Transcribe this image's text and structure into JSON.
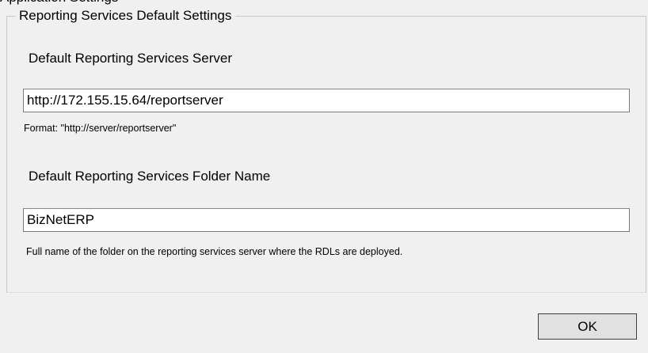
{
  "window": {
    "clipped_title": "Application Settings"
  },
  "group": {
    "title": "Reporting Services Default Settings"
  },
  "server": {
    "label": "Default Reporting Services Server",
    "value": "http://172.155.15.64/reportserver",
    "hint": "Format: \"http://server/reportserver\""
  },
  "folder": {
    "label": "Default Reporting Services Folder Name",
    "value": "BizNetERP",
    "hint": "Full name of the folder on the reporting services server where the RDLs are deployed."
  },
  "footer": {
    "ok_label": "OK"
  }
}
